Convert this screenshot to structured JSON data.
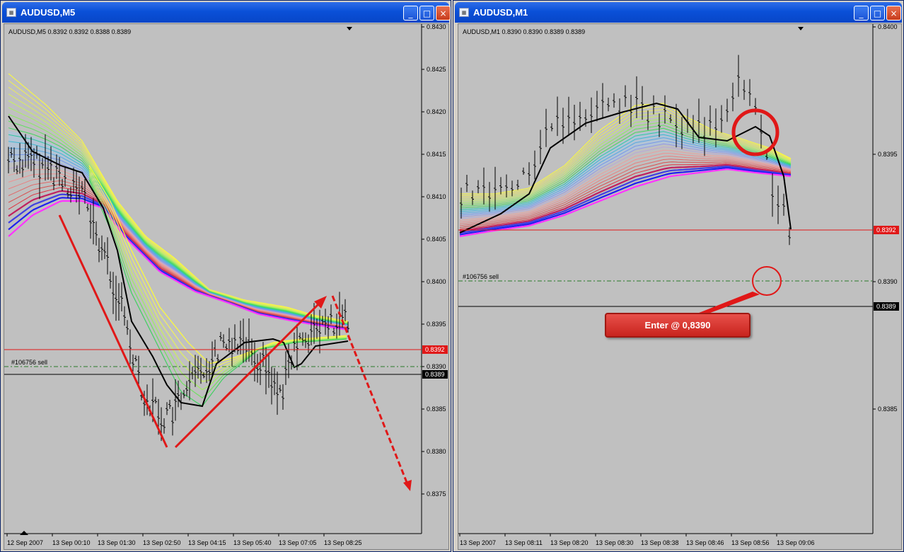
{
  "left_window": {
    "title": "AUDUSD,M5",
    "info": "AUDUSD,M5  0.8392 0.8392 0.8388 0.8389",
    "order_label": "#106756 sell",
    "price_labels": [
      "0.8430",
      "0.8425",
      "0.8420",
      "0.8415",
      "0.8410",
      "0.8405",
      "0.8400",
      "0.8395",
      "0.8390",
      "0.8385",
      "0.8380",
      "0.8375"
    ],
    "marker_red": "0.8392",
    "marker_black": "0.8389",
    "time_labels": [
      "12 Sep 2007",
      "13 Sep 00:10",
      "13 Sep 01:30",
      "13 Sep 02:50",
      "13 Sep 04:15",
      "13 Sep 05:40",
      "13 Sep 07:05",
      "13 Sep 08:25"
    ]
  },
  "right_window": {
    "title": "AUDUSD,M1",
    "info": "AUDUSD,M1  0.8390 0.8390 0.8389 0.8389",
    "order_label": "#106756 sell",
    "price_labels": [
      "0.8400",
      "0.8395",
      "0.8390",
      "0.8385"
    ],
    "marker_red": "0.8392",
    "marker_black": "0.8389",
    "time_labels": [
      "13 Sep 2007",
      "13 Sep 08:11",
      "13 Sep 08:20",
      "13 Sep 08:30",
      "13 Sep 08:38",
      "13 Sep 08:46",
      "13 Sep 08:56",
      "13 Sep 09:06"
    ],
    "callout_text": "Enter @ 0,8390"
  },
  "window_buttons": {
    "minimize": "_",
    "maximize": "□",
    "close": "×"
  },
  "colors": {
    "chart_bg": "#c0c0c0",
    "annotation": "#e01818",
    "title_bar": "#0a50d8"
  }
}
